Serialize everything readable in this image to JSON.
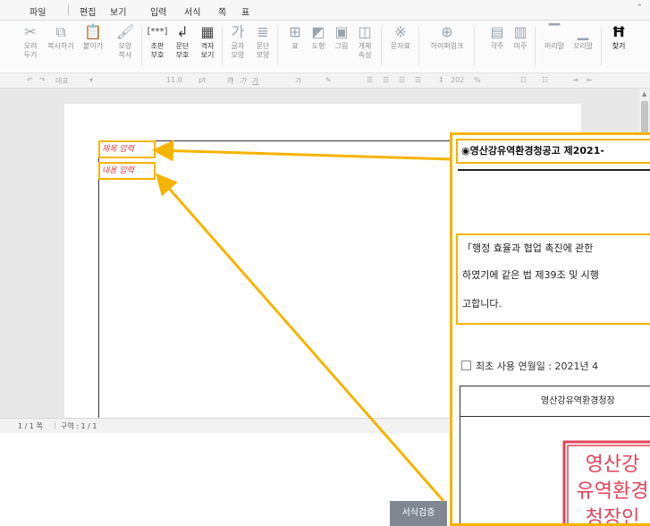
{
  "menu": {
    "items": [
      "파일",
      "편집",
      "보기",
      "입력",
      "서식",
      "쪽",
      "표"
    ]
  },
  "toolbar": {
    "cut": "오려\n두기",
    "copy": "복사하기",
    "paste": "붙이기",
    "format_copy": "모양\n복사",
    "cell_merge": "조판\n부호",
    "para_mark": "문단\n부호",
    "grid": "격자\n보기",
    "char_shape": "글자\n모양",
    "para_shape": "문단\n모양",
    "table": "표",
    "shape": "도형",
    "picture": "그림",
    "object": "개체\n속성",
    "special_char": "문자표",
    "hyperlink": "하이퍼링크",
    "footnote": "각주",
    "endnote": "미주",
    "header": "머리말",
    "footer": "꼬리말",
    "find": "찾기"
  },
  "formatbar": {
    "style": "대표",
    "font_size": "11.0",
    "unit": "pt",
    "zoom": "202",
    "zoom_unit": "%"
  },
  "fields": {
    "title_input": "제목 입력",
    "content_input": "내용 입력"
  },
  "status": {
    "page": "1 / 1 쪽",
    "section": "구역 : 1 / 1"
  },
  "buttons": {
    "verify_label": "서식검증"
  },
  "callout": {
    "title": "◉영산강유역환경청공고 제2021-",
    "body_lines": [
      "「행정 효율과 협업 촉진에 관한",
      "하였기에 같은 법 제39조 및 시행",
      "고합니다."
    ],
    "first_use": "최초 사용 연월일 : 2021년 4",
    "table_header": "영산강유역환경청장",
    "seal_text": [
      "영산강",
      "유역환경",
      "청장인"
    ]
  },
  "colors": {
    "accent": "#f5b400",
    "field_text": "#e03a3a",
    "button_bg": "#7f8791",
    "seal": "#e0445a"
  }
}
